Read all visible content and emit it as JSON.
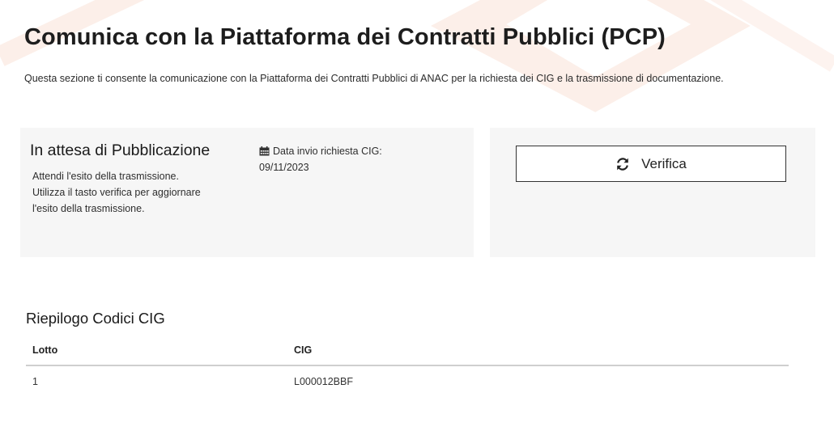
{
  "page": {
    "title": "Comunica con la Piattaforma dei Contratti Pubblici (PCP)",
    "description": "Questa sezione ti consente la comunicazione con la Piattaforma dei Contratti Pubblici di ANAC per la richiesta dei CIG e la trasmissione di documentazione."
  },
  "status_card": {
    "title": "In attesa di Pubblicazione",
    "message_lines": [
      "Attendi l'esito della trasmissione.",
      "Utilizza il tasto verifica per aggiornare",
      "l'esito della trasmissione."
    ],
    "date_icon": "calendar-icon",
    "date_label": "Data invio richiesta CIG:",
    "date_value": "09/11/2023"
  },
  "action_card": {
    "verify_icon": "refresh-icon",
    "verify_label": "Verifica"
  },
  "summary": {
    "title": "Riepilogo Codici CIG",
    "columns": [
      "Lotto",
      "CIG"
    ],
    "rows": [
      [
        "1",
        "L000012BBF"
      ]
    ]
  },
  "colors": {
    "card_background": "#f6f6f6",
    "background_decoration": "#fdf0ec"
  }
}
